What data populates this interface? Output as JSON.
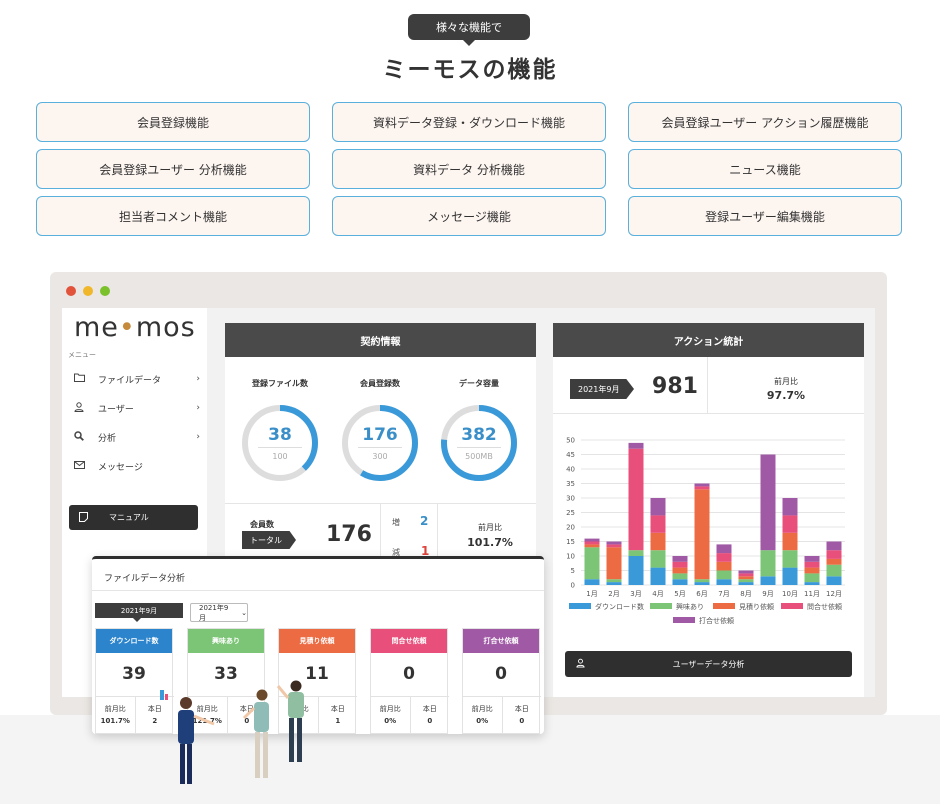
{
  "header": {
    "badge": "様々な機能で",
    "title": "ミーモスの機能"
  },
  "features": [
    "会員登録機能",
    "資料データ登録・ダウンロード機能",
    "会員登録ユーザー アクション履歴機能",
    "会員登録ユーザー 分析機能",
    "資料データ 分析機能",
    "ニュース機能",
    "担当者コメント機能",
    "メッセージ機能",
    "登録ユーザー編集機能"
  ],
  "app": {
    "logo_left": "me",
    "logo_right": "mos",
    "menu_caption": "メニュー",
    "menu": [
      {
        "label": "ファイルデータ",
        "icon": "folder-icon"
      },
      {
        "label": "ユーザー",
        "icon": "user-icon"
      },
      {
        "label": "分析",
        "icon": "search-icon"
      },
      {
        "label": "メッセージ",
        "icon": "mail-icon"
      }
    ],
    "manual_label": "マニュアル"
  },
  "contract": {
    "title": "契約情報",
    "circles": [
      {
        "label": "登録ファイル数",
        "value": "38",
        "max": "100",
        "ratio": 0.38
      },
      {
        "label": "会員登録数",
        "value": "176",
        "max": "300",
        "ratio": 0.587
      },
      {
        "label": "データ容量",
        "value": "382",
        "max": "500MB",
        "ratio": 0.764
      }
    ],
    "members_label": "会員数",
    "total_tag": "トータル",
    "total_value": "176",
    "inc_label": "増",
    "inc_value": "2",
    "dec_label": "減",
    "dec_value": "1",
    "mom_label": "前月比",
    "mom_value": "101.7%"
  },
  "action": {
    "title": "アクション統計",
    "month_tag": "2021年9月",
    "count": "981",
    "mom_label": "前月比",
    "mom_value": "97.7%",
    "button_label": "ユーザーデータ分析"
  },
  "chart_data": {
    "type": "bar",
    "stacked": true,
    "categories": [
      "1月",
      "2月",
      "3月",
      "4月",
      "5月",
      "6月",
      "7月",
      "8月",
      "9月",
      "10月",
      "11月",
      "12月"
    ],
    "ylim": [
      0,
      50
    ],
    "yticks": [
      "0",
      "5",
      "10",
      "15",
      "20",
      "25",
      "30",
      "35",
      "40",
      "45",
      "50"
    ],
    "series": [
      {
        "name": "ダウンロード数",
        "color": "#3a9ad9",
        "values": [
          2,
          1,
          10,
          6,
          2,
          1,
          2,
          1,
          3,
          6,
          1,
          3
        ]
      },
      {
        "name": "興味あり",
        "color": "#7cc576",
        "values": [
          11,
          1,
          2,
          6,
          2,
          1,
          3,
          1,
          9,
          6,
          3,
          4
        ]
      },
      {
        "name": "見積り依頼",
        "color": "#ec6b43",
        "values": [
          1,
          11,
          0,
          6,
          2,
          31,
          3,
          1,
          0,
          6,
          2,
          2
        ]
      },
      {
        "name": "問合せ依頼",
        "color": "#e84f7b",
        "values": [
          1,
          1,
          35,
          6,
          2,
          1,
          3,
          1,
          0,
          6,
          2,
          3
        ]
      },
      {
        "name": "打合せ依頼",
        "color": "#a05aa5",
        "values": [
          1,
          1,
          2,
          6,
          2,
          1,
          3,
          1,
          33,
          6,
          2,
          3
        ]
      }
    ],
    "grid": true,
    "legend": "bottom"
  },
  "file_analysis": {
    "title": "ファイルデータ分析",
    "month_tag": "2021年9月",
    "select_value": "2021年9月",
    "cards": [
      {
        "label": "ダウンロード数",
        "color": "#2b84cc",
        "value": "39",
        "mom_label": "前月比",
        "mom": "101.7%",
        "today_label": "本日",
        "today": "2"
      },
      {
        "label": "興味あり",
        "color": "#7cc576",
        "value": "33",
        "mom_label": "前月比",
        "mom": "121.7%",
        "today_label": "本日",
        "today": "0"
      },
      {
        "label": "見積り依頼",
        "color": "#ec6b43",
        "value": "11",
        "mom_label": "前月比",
        "mom": "",
        "today_label": "本日",
        "today": "1"
      },
      {
        "label": "問合せ依頼",
        "color": "#e84f7b",
        "value": "0",
        "mom_label": "前月比",
        "mom": "0%",
        "today_label": "本日",
        "today": "0"
      },
      {
        "label": "打合せ依頼",
        "color": "#a05aa5",
        "value": "0",
        "mom_label": "前月比",
        "mom": "0%",
        "today_label": "本日",
        "today": "0"
      }
    ]
  }
}
